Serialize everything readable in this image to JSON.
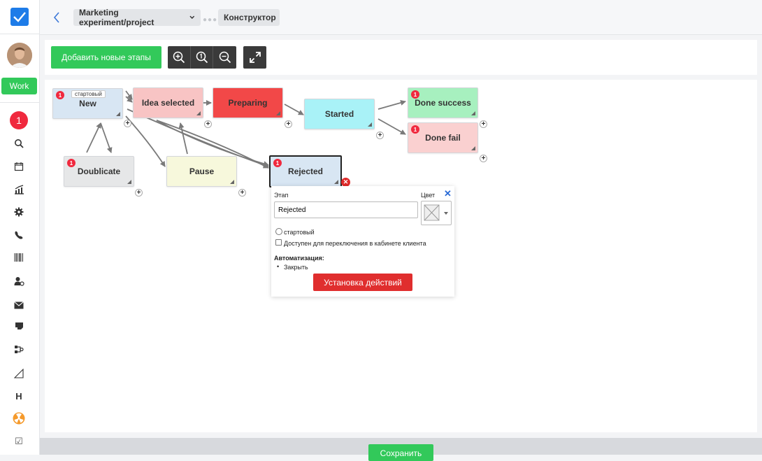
{
  "breadcrumbs": {
    "project": "Marketing experiment/project",
    "page": "Конструктор"
  },
  "sidebar": {
    "work_label": "Work",
    "notification_count": "1",
    "heading_icon_glyph": "H",
    "checkbox_icon_glyph": "☑",
    "icons": [
      "search-icon",
      "calendar-icon",
      "chart-icon",
      "gear-icon",
      "phone-icon",
      "barcode-icon",
      "user-settings-icon",
      "mail-icon",
      "document-icon",
      "flow-icon",
      "triangle-ruler-icon",
      "heading-icon",
      "radiation-icon",
      "checkbox-icon"
    ]
  },
  "toolbar": {
    "add_stages_label": "Добавить новые этапы",
    "zoom_icons": [
      "zoom-in-icon",
      "zoom-reset-icon",
      "zoom-out-icon"
    ],
    "fullscreen_icon": "expand-icon"
  },
  "stages": [
    {
      "id": "new",
      "label": "New",
      "color": "#d8e6f3",
      "badge": "1",
      "start_tag": "стартовый"
    },
    {
      "id": "idea",
      "label": "Idea selected",
      "color": "#f8c4c4",
      "badge": ""
    },
    {
      "id": "preparing",
      "label": "Preparing",
      "color": "#f24848",
      "badge": ""
    },
    {
      "id": "started",
      "label": "Started",
      "color": "#a9f2f7",
      "badge": ""
    },
    {
      "id": "success",
      "label": "Done success",
      "color": "#a7f0bf",
      "badge": "1"
    },
    {
      "id": "fail",
      "label": "Done fail",
      "color": "#fad0d0",
      "badge": "1"
    },
    {
      "id": "dup",
      "label": "Doublicate",
      "color": "#e6e7e8",
      "badge": "1"
    },
    {
      "id": "pause",
      "label": "Pause",
      "color": "#f7f8dc",
      "badge": ""
    },
    {
      "id": "rejected",
      "label": "Rejected",
      "color": "#d8e6f3",
      "badge": "1"
    }
  ],
  "popup": {
    "stage_label": "Этап",
    "color_label": "Цвет",
    "stage_value": "Rejected",
    "start_option": "стартовый",
    "client_option": "Доступен для переключения в кабинете клиента",
    "automation_label": "Автоматизация:",
    "automation_items": [
      "Закрыть"
    ],
    "actions_button": "Установка действий"
  },
  "footer": {
    "save_label": "Сохранить"
  }
}
